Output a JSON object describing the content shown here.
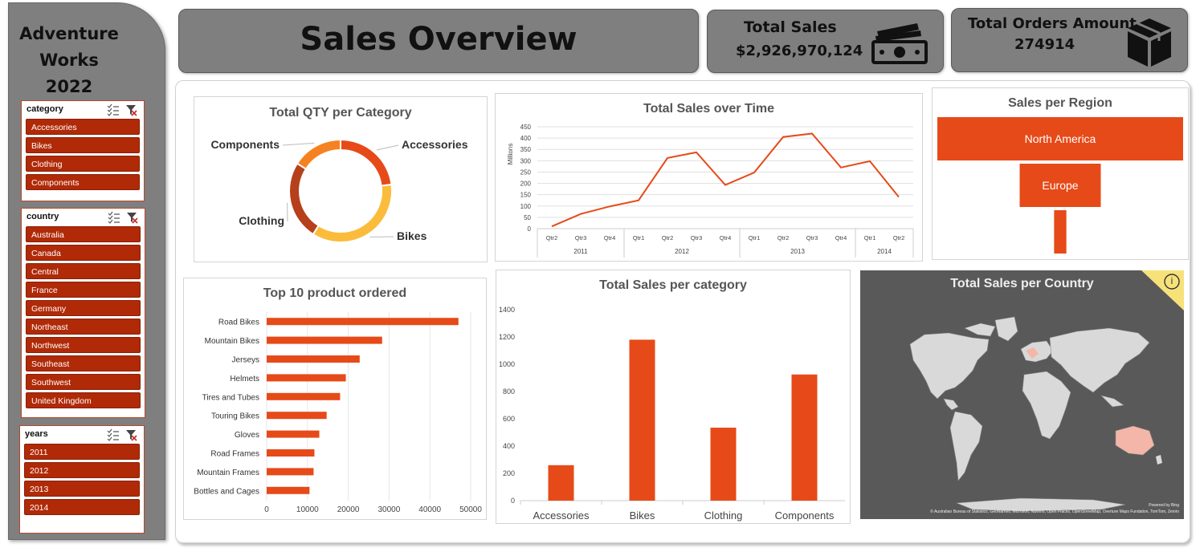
{
  "brand": {
    "line1": "Adventure",
    "line2": "Works",
    "line3": "2022"
  },
  "header": {
    "title": "Sales Overview"
  },
  "kpis": {
    "total_sales_label": "Total Sales",
    "total_sales_value": "$2,926,970,124",
    "total_orders_label": "Total Orders Amount",
    "total_orders_value": "274914"
  },
  "slicers": {
    "category": {
      "title": "category",
      "items": [
        "Accessories",
        "Bikes",
        "Clothing",
        "Components"
      ]
    },
    "country": {
      "title": "country",
      "items": [
        "Australia",
        "Canada",
        "Central",
        "France",
        "Germany",
        "Northeast",
        "Northwest",
        "Southeast",
        "Southwest",
        "United Kingdom"
      ]
    },
    "years": {
      "title": "years",
      "items": [
        "2011",
        "2012",
        "2013",
        "2014"
      ]
    }
  },
  "colors": {
    "accent": "#e64a19",
    "accent_dark": "#b02a08",
    "panel": "#7f7f7f",
    "map_bg": "#595959",
    "land": "#d9d9d9"
  },
  "charts": {
    "qty_category": {
      "title": "Total QTY per Category",
      "labels": [
        "Accessories",
        "Bikes",
        "Clothing",
        "Components"
      ],
      "values": [
        23,
        36,
        25,
        16
      ],
      "colors": [
        "#e64a19",
        "#fbbc3c",
        "#b5401b",
        "#f58220"
      ]
    },
    "sales_time": {
      "title": "Total Sales over Time",
      "ylabel": "Millions",
      "yticks": [
        "0",
        "50",
        "100",
        "150",
        "200",
        "250",
        "300",
        "350",
        "400",
        "450"
      ],
      "quarters": [
        "Qtr2",
        "Qtr3",
        "Qtr4",
        "Qtr1",
        "Qtr2",
        "Qtr3",
        "Qtr4",
        "Qtr1",
        "Qtr2",
        "Qtr3",
        "Qtr4",
        "Qtr1",
        "Qtr2"
      ],
      "years": [
        "2011",
        "2012",
        "2013",
        "2014"
      ],
      "values": [
        10,
        65,
        98,
        125,
        312,
        337,
        193,
        248,
        405,
        420,
        270,
        298,
        140
      ]
    },
    "region": {
      "title": "Sales per Region",
      "labels": [
        "North America",
        "Europe",
        ""
      ],
      "values": [
        100,
        33,
        5
      ]
    },
    "top10": {
      "title": "Top 10 product ordered",
      "labels": [
        "Road Bikes",
        "Mountain Bikes",
        "Jerseys",
        "Helmets",
        "Tires and Tubes",
        "Touring Bikes",
        "Gloves",
        "Road Frames",
        "Mountain Frames",
        "Bottles and Cages"
      ],
      "values": [
        47000,
        28300,
        22800,
        19400,
        18000,
        14700,
        12900,
        11700,
        11500,
        10500
      ],
      "xticks": [
        "0",
        "10000",
        "20000",
        "30000",
        "40000",
        "50000"
      ]
    },
    "sales_category": {
      "title": "Total Sales per category",
      "categories": [
        "Accessories",
        "Bikes",
        "Clothing",
        "Components"
      ],
      "values": [
        260,
        1180,
        535,
        925
      ],
      "yticks": [
        "0",
        "200",
        "400",
        "600",
        "800",
        "1000",
        "1200",
        "1400"
      ]
    },
    "country_map": {
      "title": "Total Sales per Country",
      "info": "i",
      "powered": "Powered by Bing",
      "credits": "© Australian Bureau of Statistics, GeoNames, Microsoft, Navinfo, Open Places, OpenStreetMap, Overture Maps Fundation, TomTom, Zenrin"
    }
  }
}
